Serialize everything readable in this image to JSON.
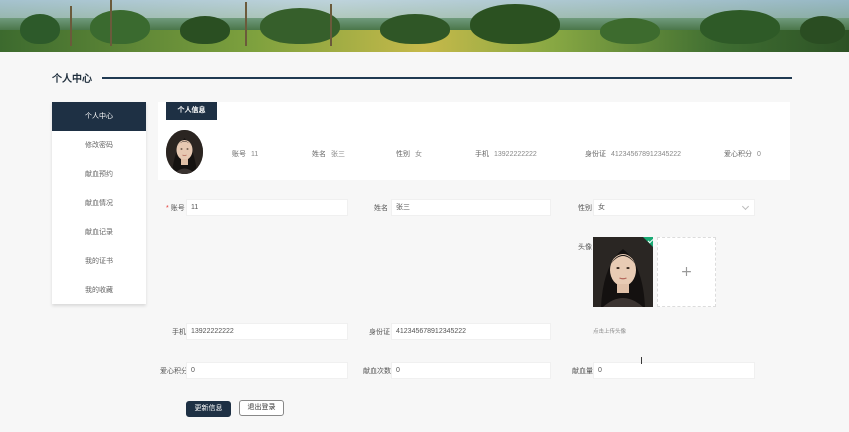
{
  "header": {
    "title": "个人中心"
  },
  "sidebar": {
    "items": [
      {
        "label": "个人中心",
        "active": true
      },
      {
        "label": "修改密码"
      },
      {
        "label": "献血预约"
      },
      {
        "label": "献血情况"
      },
      {
        "label": "献血记录"
      },
      {
        "label": "我的证书"
      },
      {
        "label": "我的收藏"
      }
    ]
  },
  "info": {
    "tag": "个人信息",
    "fields": [
      {
        "label": "账号",
        "value": "11"
      },
      {
        "label": "姓名",
        "value": "张三"
      },
      {
        "label": "性别",
        "value": "女"
      },
      {
        "label": "手机",
        "value": "13922222222"
      },
      {
        "label": "身份证",
        "value": "412345678912345222"
      },
      {
        "label": "爱心积分",
        "value": "0"
      }
    ]
  },
  "form": {
    "account": {
      "label": "账号",
      "value": "11"
    },
    "name": {
      "label": "姓名",
      "value": "张三"
    },
    "gender": {
      "label": "性别",
      "value": "女"
    },
    "avatar": {
      "label": "头像",
      "hint": "点击上传头像"
    },
    "phone": {
      "label": "手机",
      "value": "13922222222"
    },
    "idcard": {
      "label": "身份证",
      "value": "412345678912345222"
    },
    "points": {
      "label": "爱心积分",
      "value": "0"
    },
    "donations": {
      "label": "献血次数",
      "value": "0"
    },
    "volume": {
      "label": "献血量",
      "value": "0"
    }
  },
  "buttons": {
    "update": "更新信息",
    "logout": "退出登录"
  },
  "colors": {
    "primary": "#1e3044",
    "badge": "#19a974"
  }
}
